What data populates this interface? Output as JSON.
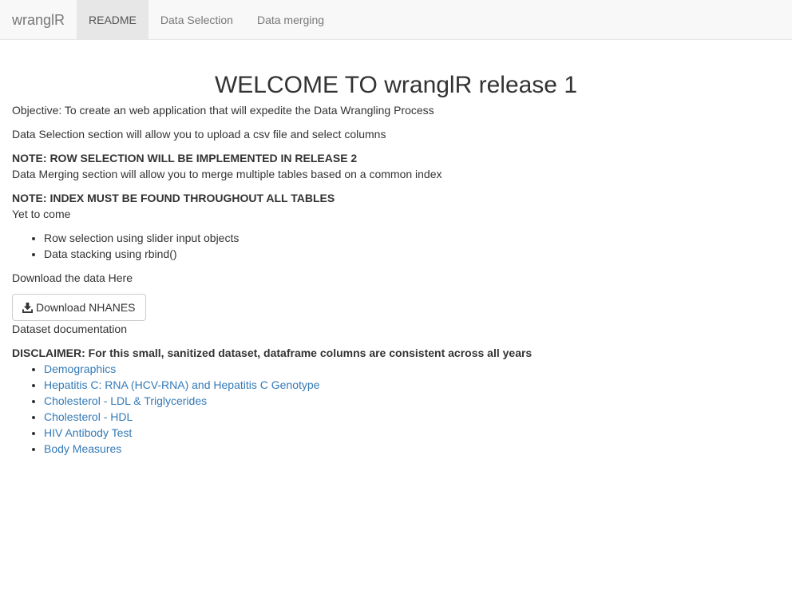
{
  "navbar": {
    "brand": "wranglR",
    "tabs": [
      {
        "label": "README",
        "active": true
      },
      {
        "label": "Data Selection",
        "active": false
      },
      {
        "label": "Data merging",
        "active": false
      }
    ]
  },
  "main": {
    "title": "WELCOME TO wranglR release 1",
    "objective": "Objective: To create an web application that will expedite the Data Wrangling Process",
    "data_selection_text": "Data Selection section will allow you to upload a csv file and select columns",
    "note_row": "NOTE: ROW SELECTION WILL BE IMPLEMENTED IN RELEASE 2",
    "data_merging_text": "Data Merging section will allow you to merge multiple tables based on a common index",
    "note_index": "NOTE: INDEX MUST BE FOUND THROUGHOUT ALL TABLES",
    "yet_to_come": "Yet to come",
    "upcoming": [
      "Row selection using slider input objects",
      "Data stacking using rbind()"
    ],
    "download_text": "Download the data Here",
    "download_button": "Download NHANES",
    "download_icon": "download-icon",
    "doc_label": "Dataset documentation",
    "disclaimer": "DISCLAIMER: For this small, sanitized dataset, dataframe columns are consistent across all years",
    "doc_links": [
      "Demographics",
      "Hepatitis C: RNA (HCV-RNA) and Hepatitis C Genotype",
      "Cholesterol - LDL & Triglycerides",
      "Cholesterol - HDL",
      "HIV Antibody Test",
      "Body Measures"
    ]
  },
  "colors": {
    "link": "#337ab7",
    "navbar_bg": "#f8f8f8",
    "active_tab_bg": "#e7e7e7",
    "text": "#333333"
  }
}
